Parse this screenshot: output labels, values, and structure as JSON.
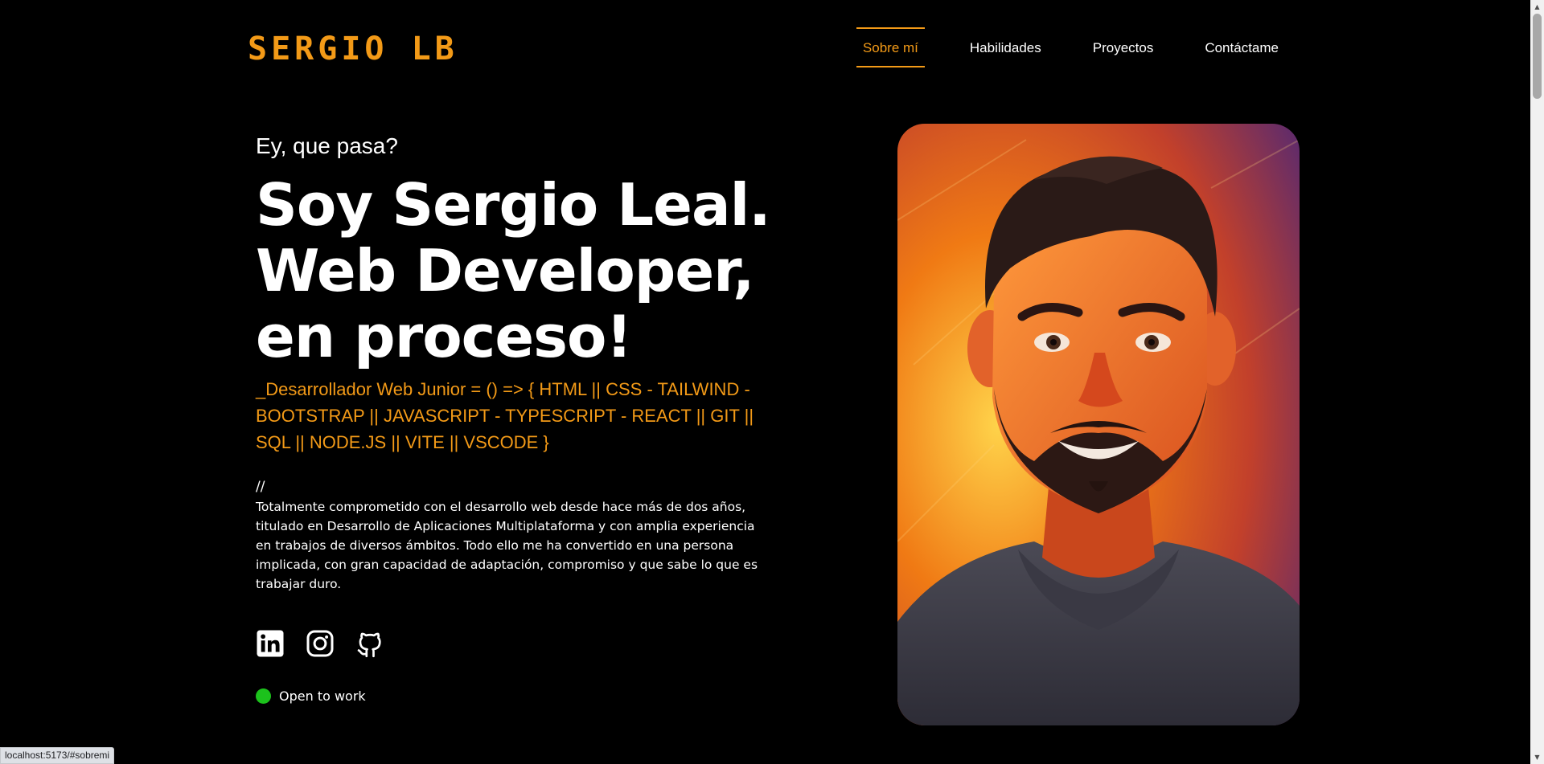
{
  "brand": {
    "logo_text": "SERGIO LB",
    "accent": "#f39a17"
  },
  "nav": {
    "items": [
      {
        "label": "Sobre mí",
        "active": true
      },
      {
        "label": "Habilidades",
        "active": false
      },
      {
        "label": "Proyectos",
        "active": false
      },
      {
        "label": "Contáctame",
        "active": false
      }
    ]
  },
  "hero": {
    "greeting": "Ey, que pasa?",
    "headline": [
      "Soy Sergio Leal.",
      "Web Developer,",
      "en proceso!"
    ],
    "skills": "_Desarrollador Web Junior = () => { HTML || CSS - TAILWIND - BOOTSTRAP || JAVASCRIPT - TYPESCRIPT - REACT || GIT || SQL || NODE.JS || VITE || VSCODE }",
    "comment": "//",
    "bio": "Totalmente comprometido con el desarrollo web desde hace más de dos años, titulado en Desarrollo de Aplicaciones Multiplataforma y con amplia experiencia en trabajos de diversos ámbitos. Todo ello me ha convertido en una persona implicada, con gran capacidad de adaptación, compromiso y que sabe lo que es trabajar duro.",
    "socials": [
      {
        "icon": "linkedin-icon"
      },
      {
        "icon": "instagram-icon"
      },
      {
        "icon": "github-icon"
      }
    ],
    "status": {
      "label": "Open to work",
      "color": "#1cc21c"
    }
  },
  "browser": {
    "status_url": "localhost:5173/#sobremi"
  }
}
